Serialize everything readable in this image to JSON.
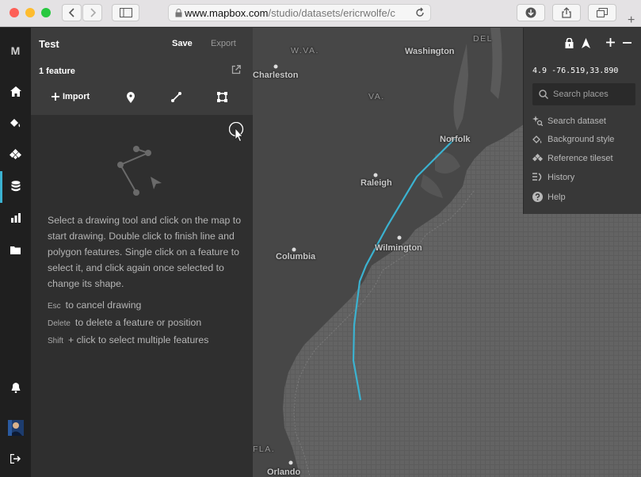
{
  "browser": {
    "url_domain": "www.mapbox.com",
    "url_rest": "/studio/datasets/ericrwolfe/c"
  },
  "sidebar": {
    "logo": "M",
    "items": [
      {
        "icon": "home-icon"
      },
      {
        "icon": "paint-bucket-icon"
      },
      {
        "icon": "tileset-icon"
      },
      {
        "icon": "database-icon",
        "active": true
      },
      {
        "icon": "bar-chart-icon"
      },
      {
        "icon": "folder-icon"
      }
    ],
    "bottom": [
      {
        "icon": "bell-icon"
      },
      {
        "icon": "avatar"
      },
      {
        "icon": "logout-icon"
      }
    ]
  },
  "panel": {
    "title": "Test",
    "save_label": "Save",
    "export_label": "Export",
    "feature_count": "1 feature",
    "import_label": "Import",
    "help_text": "Select a drawing tool and click on the map to start drawing. Double click to finish line and polygon features. Single click on a feature to select it, and click again once selected to change its shape.",
    "shortcuts": [
      {
        "key": "Esc",
        "desc": "to cancel drawing"
      },
      {
        "key": "Delete",
        "desc": "to delete a feature or position"
      },
      {
        "key": "Shift",
        "desc": "+ click to select multiple features"
      }
    ]
  },
  "map": {
    "labels": [
      {
        "text": "W.VA.",
        "kind": "state"
      },
      {
        "text": "Washington",
        "kind": "city"
      },
      {
        "text": "DEL",
        "kind": "state"
      },
      {
        "text": "Charleston",
        "kind": "city"
      },
      {
        "text": "VA.",
        "kind": "state"
      },
      {
        "text": "Norfolk",
        "kind": "city"
      },
      {
        "text": "Raleigh",
        "kind": "city"
      },
      {
        "text": "Wilmington",
        "kind": "city"
      },
      {
        "text": "Columbia",
        "kind": "city"
      },
      {
        "text": "FLA.",
        "kind": "state"
      },
      {
        "text": "Orlando",
        "kind": "city"
      }
    ],
    "line_color": "#3bb2d0"
  },
  "controls": {
    "coords": "4.9  -76.519,33.890",
    "search_placeholder": "Search places",
    "menu": [
      {
        "label": "Search dataset",
        "icon": "sparkle-search-icon"
      },
      {
        "label": "Background style",
        "icon": "paint-bucket-icon"
      },
      {
        "label": "Reference tileset",
        "icon": "tileset-icon"
      },
      {
        "label": "History",
        "icon": "history-icon"
      },
      {
        "label": "Help",
        "icon": "help-icon"
      }
    ]
  },
  "colors": {
    "accent": "#3bb2d0",
    "rail": "#1f1f1f",
    "panel": "#2d2d2d",
    "map_land": "#454545",
    "map_water": "#5a5a5a"
  }
}
